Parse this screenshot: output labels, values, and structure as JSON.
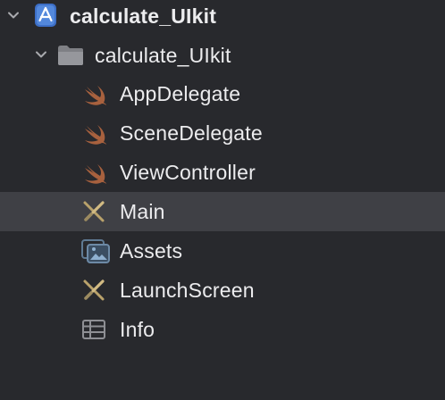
{
  "project": {
    "name": "calculate_UIkit",
    "icon": "xcode-project-icon",
    "expanded": true
  },
  "group": {
    "name": "calculate_UIkit",
    "icon": "folder-icon",
    "expanded": true
  },
  "files": [
    {
      "label": "AppDelegate",
      "icon": "swift-icon"
    },
    {
      "label": "SceneDelegate",
      "icon": "swift-icon"
    },
    {
      "label": "ViewController",
      "icon": "swift-icon"
    },
    {
      "label": "Main",
      "icon": "storyboard-icon",
      "selected": true
    },
    {
      "label": "Assets",
      "icon": "asset-catalog-icon"
    },
    {
      "label": "LaunchScreen",
      "icon": "storyboard-icon"
    },
    {
      "label": "Info",
      "icon": "plist-icon"
    }
  ],
  "colors": {
    "background": "#28292d",
    "selection": "#3f4045",
    "text": "#ececee",
    "swift": "#a8613e",
    "project_blue": "#4a7fd4",
    "folder": "#8e8f94"
  }
}
